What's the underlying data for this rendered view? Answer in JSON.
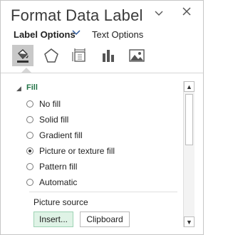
{
  "pane": {
    "title": "Format Data Label",
    "header_icons": {
      "menu": "chevron-down-icon",
      "close": "close-icon"
    }
  },
  "tabs": [
    {
      "label": "Label Options",
      "active": true
    },
    {
      "label": "Text Options",
      "active": false
    }
  ],
  "icon_buttons": [
    {
      "icon": "fill-line-icon",
      "selected": true
    },
    {
      "icon": "effects-pentagon-icon",
      "selected": false
    },
    {
      "icon": "size-properties-icon",
      "selected": false
    },
    {
      "icon": "label-options-chart-icon",
      "selected": false
    },
    {
      "icon": "picture-icon",
      "selected": false
    }
  ],
  "section": {
    "title": "Fill"
  },
  "fill_options": [
    {
      "label": "No fill",
      "selected": false
    },
    {
      "label": "Solid fill",
      "selected": false
    },
    {
      "label": "Gradient fill",
      "selected": false
    },
    {
      "label": "Picture or texture fill",
      "selected": true
    },
    {
      "label": "Pattern fill",
      "selected": false
    },
    {
      "label": "Automatic",
      "selected": false
    }
  ],
  "picture_source": {
    "label": "Picture source",
    "insert_button": "Insert...",
    "clipboard_button": "Clipboard"
  },
  "colors": {
    "accent_green": "#217346",
    "selected_icon_bg": "#c8c8c8",
    "primary_button_bg": "#dff3e6"
  }
}
